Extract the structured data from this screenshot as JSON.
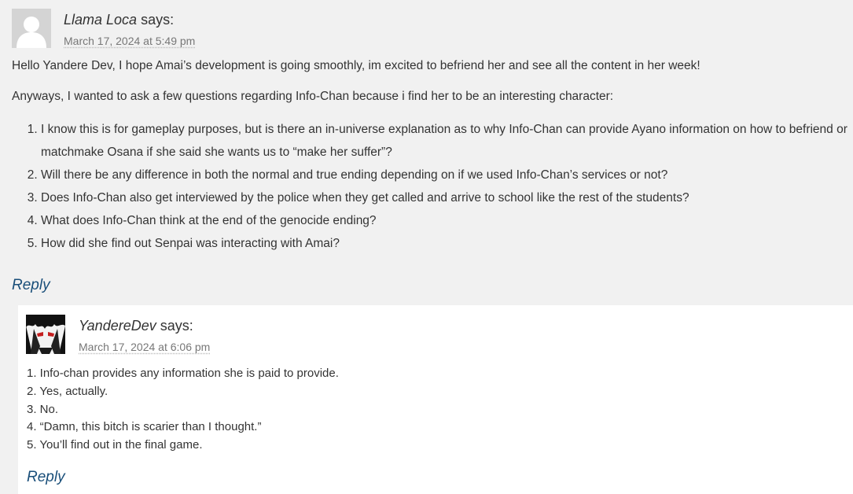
{
  "parent_comment": {
    "author": "Llama Loca",
    "says": "says:",
    "date": "March 17, 2024 at 5:49 pm",
    "paragraphs": [
      "Hello Yandere Dev, I hope Amai’s development is going smoothly, im excited to befriend her and see all the content in her week!",
      "Anyways, I wanted to ask a few questions regarding Info-Chan because i find her to be an interesting character:"
    ],
    "questions": [
      "I know this is for gameplay purposes, but is there an in-universe explanation as to why Info-Chan can provide Ayano information on how to befriend or matchmake Osana if she said she wants us to “make her suffer”?",
      "Will there be any difference in both the normal and true ending depending on if we used Info-Chan’s services or not?",
      "Does Info-Chan also get interviewed by the police when they get called and arrive to school like the rest of the students?",
      "What does Info-Chan think at the end of the genocide ending?",
      "How did she find out Senpai was interacting with Amai?"
    ],
    "reply_label": "Reply",
    "avatar_icon": "default-user-avatar-icon"
  },
  "child_comment": {
    "author": "YandereDev",
    "says": "says:",
    "date": "March 17, 2024 at 6:06 pm",
    "answers": [
      "1. Info-chan provides any information she is paid to provide.",
      "2. Yes, actually.",
      "3. No.",
      "4. “Damn, this bitch is scarier than I thought.”",
      "5. You’ll find out in the final game."
    ],
    "reply_label": "Reply",
    "avatar_icon": "anime-character-avatar-icon"
  },
  "colors": {
    "page_background": "#f1f1f1",
    "child_background": "#ffffff",
    "link": "#1a4f7a",
    "text": "#333333",
    "date": "#777777"
  }
}
